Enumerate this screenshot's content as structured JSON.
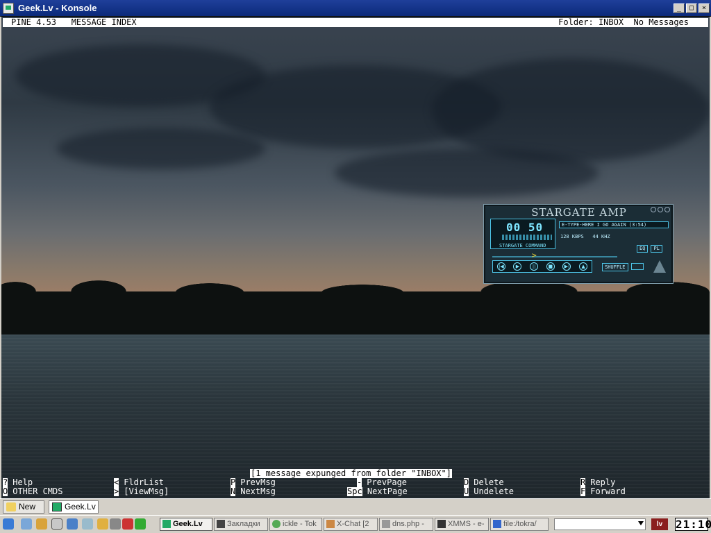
{
  "window": {
    "title": "Geek.Lv - Konsole",
    "buttons": {
      "minimize": "_",
      "maximize": "□",
      "close": "×"
    }
  },
  "pine": {
    "header_left": "PINE 4.53   MESSAGE INDEX",
    "header_right": "Folder: INBOX  No Messages",
    "status_message": "[1 message expunged from folder \"INBOX\"]",
    "menu": [
      {
        "key": "?",
        "label": " Help"
      },
      {
        "key": "<",
        "label": " FldrList"
      },
      {
        "key": "P",
        "label": " PrevMsg"
      },
      {
        "key": "-",
        "label": " PrevPage"
      },
      {
        "key": "D",
        "label": " Delete"
      },
      {
        "key": "R",
        "label": " Reply"
      },
      {
        "key": "O",
        "label": " OTHER CMDS"
      },
      {
        "key": ">",
        "label": " [ViewMsg]"
      },
      {
        "key": "N",
        "label": " NextMsg"
      },
      {
        "key": "Spc",
        "label": " NextPage"
      },
      {
        "key": "U",
        "label": " Undelete"
      },
      {
        "key": "F",
        "label": " Forward"
      }
    ]
  },
  "amp": {
    "title": "STARGATE AMP",
    "time": "00 50",
    "song": "E-TYPE-HERE I GO AGAIN (3:54)",
    "kbps": "128 KBPS   44 KHZ",
    "command": "STARGATE COMMAND",
    "eq": "EQ",
    "pl": "PL",
    "shuffle": "SHUFFLE"
  },
  "winlist": {
    "new_label": "New",
    "window_label": "Geek.Lv"
  },
  "taskbar": {
    "tasks": [
      {
        "label": "Geek.Lv",
        "active": true,
        "icon": "konsole-icon",
        "color": "#2a6"
      },
      {
        "label": "Закладки",
        "active": false,
        "icon": "x-icon",
        "color": "#444"
      },
      {
        "label": "ickle - Tok",
        "active": false,
        "icon": "ickle-icon",
        "color": "#5a5"
      },
      {
        "label": "X-Chat [2",
        "active": false,
        "icon": "xchat-icon",
        "color": "#c84"
      },
      {
        "label": "dns.php -",
        "active": false,
        "icon": "file-icon",
        "color": "#999"
      },
      {
        "label": "XMMS - e-",
        "active": false,
        "icon": "xmms-icon",
        "color": "#333"
      },
      {
        "label": "file:/tokra/",
        "active": false,
        "icon": "konqueror-icon",
        "color": "#36c"
      }
    ],
    "lang": "lv",
    "clock": "21:10"
  }
}
